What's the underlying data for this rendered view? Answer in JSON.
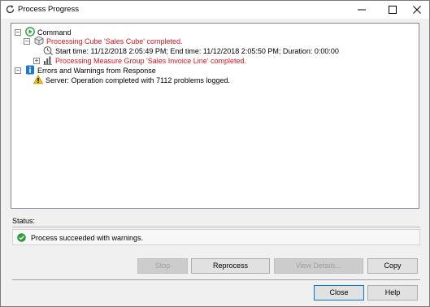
{
  "window": {
    "title": "Process Progress"
  },
  "tree": {
    "command_label": "Command",
    "cube_label": "Processing Cube 'Sales Cube' completed.",
    "time_label": "Start time: 11/12/2018 2:05:49 PM; End time: 11/12/2018 2:05:50 PM; Duration: 0:00:00",
    "measure_label": "Processing Measure Group 'Sales Invoice Line' completed.",
    "errors_label": "Errors and Warnings from Response",
    "server_label": "Server: Operation completed with 7112 problems logged."
  },
  "status": {
    "label": "Status:",
    "text": "Process succeeded with warnings."
  },
  "buttons": {
    "stop": "Stop",
    "reprocess": "Reprocess",
    "view_details": "View Details...",
    "copy": "Copy",
    "close": "Close",
    "help": "Help"
  },
  "colors": {
    "error_text": "#e3121a",
    "success": "#2e9e3f",
    "warning": "#f2c200",
    "info": "#1e7ac8"
  },
  "icons": {
    "title": "refresh-icon",
    "command": "play-icon",
    "cube": "cube-icon",
    "time": "clock-icon",
    "measure": "chart-bars-icon",
    "errors": "info-icon",
    "server": "warning-icon",
    "status": "check-circle-icon"
  }
}
